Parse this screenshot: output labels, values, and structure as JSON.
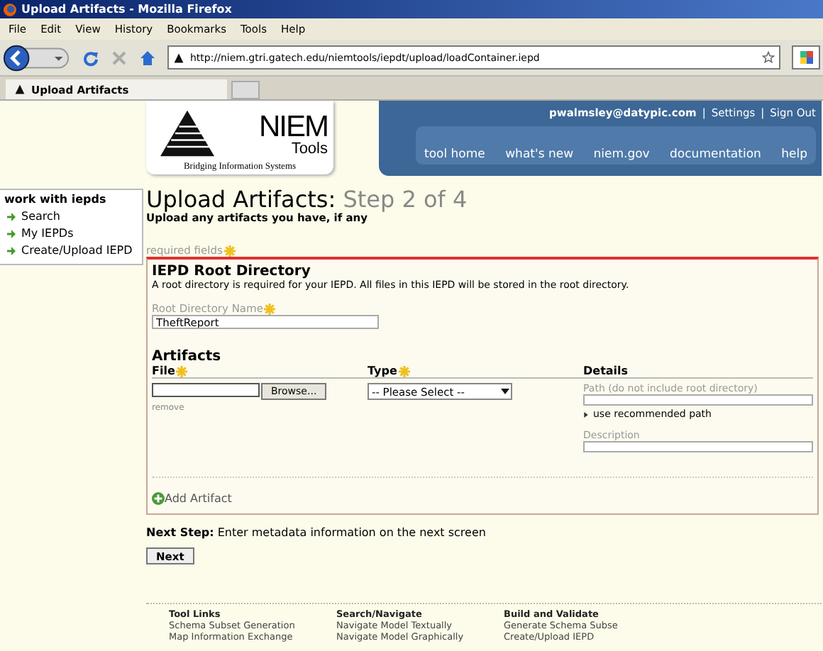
{
  "window": {
    "title": "Upload Artifacts - Mozilla Firefox"
  },
  "menu": [
    "File",
    "Edit",
    "View",
    "History",
    "Bookmarks",
    "Tools",
    "Help"
  ],
  "address_bar": {
    "value": "http://niem.gtri.gatech.edu/niemtools/iepdt/upload/loadContainer.iepd"
  },
  "tabs": [
    {
      "label": "Upload Artifacts",
      "selected": true
    }
  ],
  "logo": {
    "name": "NIEM",
    "sub": "Tools",
    "tagline": "Bridging Information Systems"
  },
  "user_links": [
    {
      "kind": "link",
      "text": "pwalmsley@datypic.com"
    },
    {
      "kind": "separator",
      "text": "|"
    },
    {
      "kind": "link",
      "text": "Settings"
    },
    {
      "kind": "separator",
      "text": "|"
    },
    {
      "kind": "link",
      "text": "Sign Out"
    }
  ],
  "nav": [
    "tool home",
    "what's new",
    "niem.gov",
    "documentation",
    "help"
  ],
  "sidebar": {
    "title": "work with iepds",
    "items": [
      "Search",
      "My IEPDs",
      "Create/Upload IEPD"
    ]
  },
  "page": {
    "title": "Upload Artifacts:",
    "step": "Step 2 of 4",
    "subtitle": "Upload any artifacts you have, if any",
    "required_note": "required fields"
  },
  "root_section": {
    "title": "IEPD Root Directory",
    "description": "A root directory is required for your IEPD. All files in this IEPD will be stored in the root directory.",
    "field_label": "Root Directory Name",
    "field_value": "TheftReport"
  },
  "artifacts": {
    "title": "Artifacts",
    "columns": [
      {
        "label": "File",
        "required": true
      },
      {
        "label": "Type",
        "required": true
      },
      {
        "label": "Details",
        "required": false
      }
    ],
    "browse": "Browse...",
    "remove": "remove",
    "type_select": "-- Please Select --",
    "path_label": "Path (do not include root directory)",
    "recommend_link": "use recommended path",
    "description_label": "Description",
    "add": "Add Artifact"
  },
  "next_step": {
    "label": "Next Step:",
    "text": "Enter metadata information on the next screen",
    "button": "Next"
  },
  "footer": [
    {
      "title": "Tool Links",
      "links": [
        "Schema Subset Generation",
        "Map Information Exchange"
      ]
    },
    {
      "title": "Search/Navigate",
      "links": [
        "Navigate Model Textually",
        "Navigate Model Graphically"
      ]
    },
    {
      "title": "Build and Validate",
      "links": [
        "Generate Schema Subse",
        "Create/Upload IEPD"
      ]
    }
  ]
}
